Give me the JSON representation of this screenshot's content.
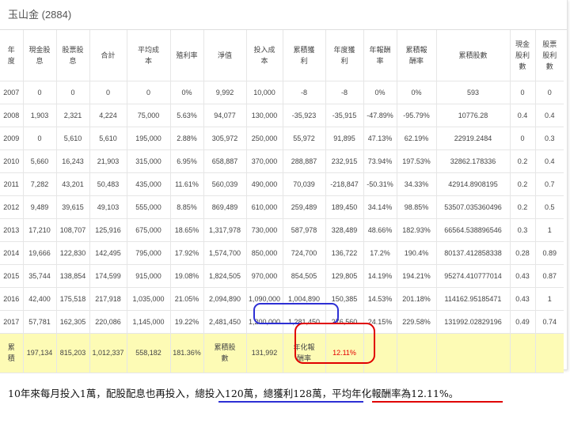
{
  "panel": {
    "title": "玉山金 (2884)"
  },
  "table": {
    "headers": [
      "年\n度",
      "現金股\n息",
      "股票股\n息",
      "合計",
      "平均成\n本",
      "殖利率",
      "淨值",
      "投入成\n本",
      "累積獲\n利",
      "年度獲\n利",
      "年報酬\n率",
      "累積報\n酬率",
      "累積股數",
      "現金\n股利\n數",
      "股票\n股利\n數"
    ],
    "rows": [
      [
        "2007",
        "0",
        "0",
        "0",
        "0",
        "0%",
        "9,992",
        "10,000",
        "-8",
        "-8",
        "0%",
        "0%",
        "593",
        "0",
        "0"
      ],
      [
        "2008",
        "1,903",
        "2,321",
        "4,224",
        "75,000",
        "5.63%",
        "94,077",
        "130,000",
        "-35,923",
        "-35,915",
        "-47.89%",
        "-95.79%",
        "10776.28",
        "0.4",
        "0.4"
      ],
      [
        "2009",
        "0",
        "5,610",
        "5,610",
        "195,000",
        "2.88%",
        "305,972",
        "250,000",
        "55,972",
        "91,895",
        "47.13%",
        "62.19%",
        "22919.2484",
        "0",
        "0.3"
      ],
      [
        "2010",
        "5,660",
        "16,243",
        "21,903",
        "315,000",
        "6.95%",
        "658,887",
        "370,000",
        "288,887",
        "232,915",
        "73.94%",
        "197.53%",
        "32862.178336",
        "0.2",
        "0.4"
      ],
      [
        "2011",
        "7,282",
        "43,201",
        "50,483",
        "435,000",
        "11.61%",
        "560,039",
        "490,000",
        "70,039",
        "-218,847",
        "-50.31%",
        "34.33%",
        "42914.8908195",
        "0.2",
        "0.7"
      ],
      [
        "2012",
        "9,489",
        "39,615",
        "49,103",
        "555,000",
        "8.85%",
        "869,489",
        "610,000",
        "259,489",
        "189,450",
        "34.14%",
        "98.85%",
        "53507.035360496",
        "0.2",
        "0.5"
      ],
      [
        "2013",
        "17,210",
        "108,707",
        "125,916",
        "675,000",
        "18.65%",
        "1,317,978",
        "730,000",
        "587,978",
        "328,489",
        "48.66%",
        "182.93%",
        "66564.538896546",
        "0.3",
        "1"
      ],
      [
        "2014",
        "19,666",
        "122,830",
        "142,495",
        "795,000",
        "17.92%",
        "1,574,700",
        "850,000",
        "724,700",
        "136,722",
        "17.2%",
        "190.4%",
        "80137.412858338",
        "0.28",
        "0.89"
      ],
      [
        "2015",
        "35,744",
        "138,854",
        "174,599",
        "915,000",
        "19.08%",
        "1,824,505",
        "970,000",
        "854,505",
        "129,805",
        "14.19%",
        "194.21%",
        "95274.410777014",
        "0.43",
        "0.87"
      ],
      [
        "2016",
        "42,400",
        "175,518",
        "217,918",
        "1,035,000",
        "21.05%",
        "2,094,890",
        "1,090,000",
        "1,004,890",
        "150,385",
        "14.53%",
        "201.18%",
        "114162.95185471",
        "0.43",
        "1"
      ],
      [
        "2017",
        "57,781",
        "162,305",
        "220,086",
        "1,145,000",
        "19.22%",
        "2,481,450",
        "1,200,000",
        "1,281,450",
        "276,560",
        "24.15%",
        "229.58%",
        "131992.02829196",
        "0.49",
        "0.74"
      ]
    ],
    "total": {
      "label": "累\n積",
      "cash": "197,134",
      "stock": "815,203",
      "sum": "1,012,337",
      "avg_cost": "558,182",
      "yield": "181.36%",
      "shares_label": "累積股\n數",
      "shares": "131,992",
      "annualized_label": "年化報\n酬率",
      "annualized": "12.11%"
    }
  },
  "summary": {
    "part1": "10年來每月投入1萬，配股配息也再投入，",
    "part2": "總投入120萬，總獲利128萬",
    "part3": "，",
    "part4": "平均年化報酬率為12.11%",
    "part5": "。"
  },
  "colors": {
    "highlight_blue": "#2d2fd4",
    "highlight_red": "#e00000",
    "total_row_bg": "#fdfbb5"
  }
}
